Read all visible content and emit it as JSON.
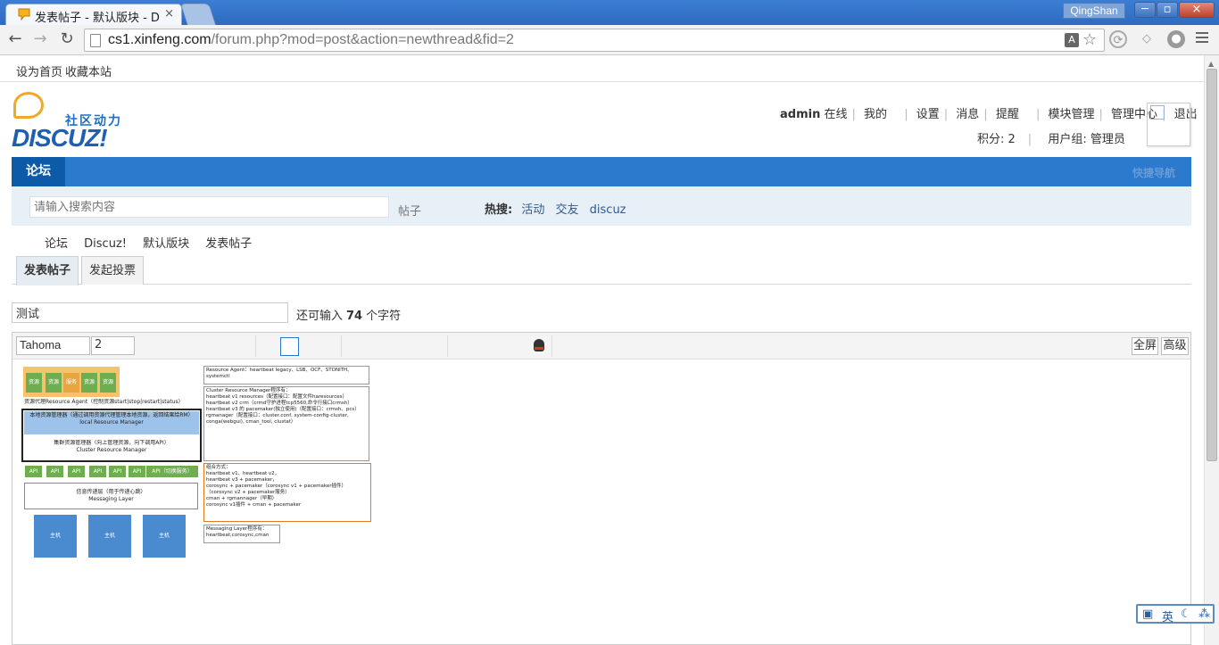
{
  "browser": {
    "tab_title": "发表帖子 - 默认版块 - Dis",
    "tab_close": "×",
    "user_name": "QingShan",
    "url_host": "cs1.xinfeng.com",
    "url_path": "/forum.php?mod=post&action=newthread&fid=2",
    "win_min": "─",
    "win_max": "▫",
    "win_close": "×"
  },
  "bookmarks": [
    "设为首页",
    "收藏本站"
  ],
  "logo": {
    "slogan": "社区动力",
    "brand": "DISCUZ!"
  },
  "user_nav": {
    "username": "admin",
    "status": "在线",
    "items": [
      "我的",
      "设置",
      "消息",
      "提醒",
      "模块管理",
      "管理中心",
      "退出"
    ],
    "points": "积分: 2",
    "group": "用户组: 管理员"
  },
  "navbar": {
    "forum": "论坛",
    "quick_nav": "快捷导航"
  },
  "search": {
    "placeholder": "请输入搜索内容",
    "type": "帖子",
    "hot_label": "热搜:",
    "hot_keywords": [
      "活动",
      "交友",
      "discuz"
    ]
  },
  "breadcrumb": [
    "论坛",
    "Discuz!",
    "默认版块",
    "发表帖子"
  ],
  "post_tabs": [
    "发表帖子",
    "发起投票"
  ],
  "subject": {
    "value": "测试",
    "hint_before": "还可输入",
    "remaining": "74",
    "hint_after": "个字符"
  },
  "editor": {
    "font": "Tahoma",
    "size": "2",
    "fullscreen": "全屏",
    "advanced": "高级"
  },
  "diagram": {
    "top_blocks": [
      "资源",
      "资源",
      "服务",
      "资源",
      "资源"
    ],
    "agent_label": "资源代理Resource Agent（控制资源start|stop|restart|status）",
    "lrm_label": "本地资源管理器（通过调用资源代理管理本地资源，返回结果给RM）",
    "lrm_en": "local Resource Manager",
    "crm_label": "集群资源管理器（向上管理资源，向下调用API）",
    "crm_en": "Cluster Resource Manager",
    "api_blocks": [
      "API",
      "API",
      "API",
      "API",
      "API",
      "API",
      "API（切换服务）"
    ],
    "messaging_label": "信息传递层（用于传递心跳）",
    "messaging_en": "Messaging Layer",
    "hosts": [
      "主机",
      "主机",
      "主机"
    ],
    "note_ra": "Resource Agent：heartbeat legacy、LSB、OCF、STONITH、systemctl",
    "note_crm": "Cluster Resource Manager程序有：\nheartbeat v1 resources（配置接口：配置文件haresources）\nheartbeat v2 crm（crmd守护进程tcp5560,命令行接口crmsh）\nheartbeat v3 的 pacemaker(独立使用)（配置接口：crmsh、pcs）\nrgmanager（配置接口：cluster.conf, system-config-cluster, conga(webgui), cman_tool, clustat）",
    "note_combo": "组合方式：\nheartbeat v1、heartbeat v2，\nheartbeat v3 + pacemaker，\ncorosync + pacemaker（corosync v1 + pacemaker插件）\n（corosync v2 + pacemaker服务）\ncman + rgmannager（早期）\ncorosync v1插件 + cman + pacemaker",
    "note_ml": "Messaging Layer程序有：\nheartbeat,corosync,cman"
  },
  "ime": {
    "mode": "英"
  }
}
